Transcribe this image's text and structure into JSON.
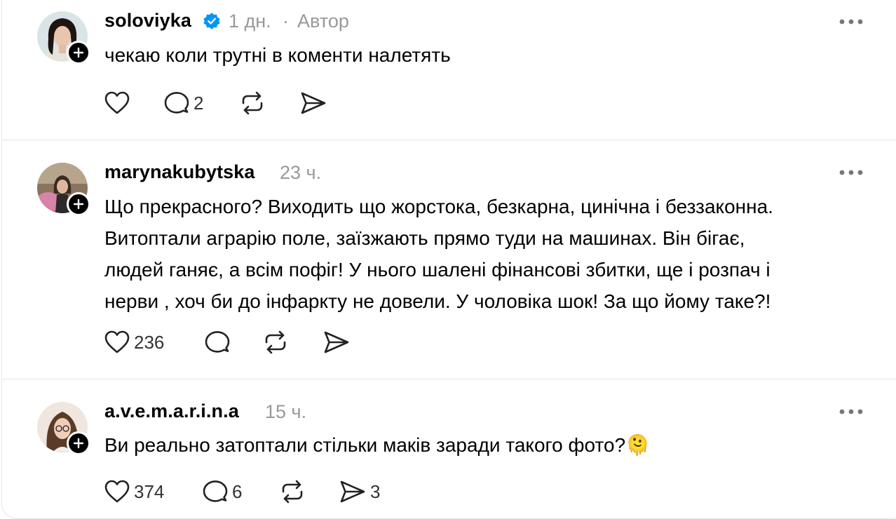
{
  "posts": [
    {
      "username": "soloviyka",
      "verified": true,
      "time": "1 дн.",
      "separator": "·",
      "author_label": "Автор",
      "text": "чекаю коли трутні в коменти налетять",
      "likes": "",
      "replies": "2",
      "shares": ""
    },
    {
      "username": "marynakubytska",
      "verified": false,
      "time": "23 ч.",
      "text": "Що прекрасного? Виходить що жорстока, безкарна, цинічна і беззаконна. Витоптали аграрію поле, заїзжають прямо туди на машинах. Він бігає, людей ганяє, а всім пофіг! У нього шалені фінансові збитки, ще і розпач і нерви , хоч би до інфаркту не довели. У чоловіка шок! За що йому таке?!",
      "text_lines": [
        "Що прекрасного? Виходить що жорстока, безкарна, цинічна і беззаконна.",
        "Витоптали аграрію поле, заїзжають прямо туди на машинах. Він бігає,",
        "людей ганяє, а всім пофіг! У нього шалені фінансові збитки, ще і розпач і",
        "нерви , хоч би до інфаркту не довели. У чоловіка шок! За що йому таке?!"
      ],
      "likes": "236",
      "replies": "",
      "shares": ""
    },
    {
      "username": "a.v.e.m.a.r.i.n.a",
      "verified": false,
      "time": "15 ч.",
      "text": "Ви реально затоптали стільки маків заради такого фото?",
      "emoji": "🫠",
      "likes": "374",
      "replies": "6",
      "shares": "3"
    }
  ],
  "icons": [
    "verified-badge-icon",
    "more-dots-icon",
    "heart-icon",
    "comment-icon",
    "repost-icon",
    "share-icon",
    "follow-plus-icon"
  ],
  "colors": {
    "verified": "#0095f6",
    "meta": "#999999",
    "divider": "#e3e3e3"
  }
}
